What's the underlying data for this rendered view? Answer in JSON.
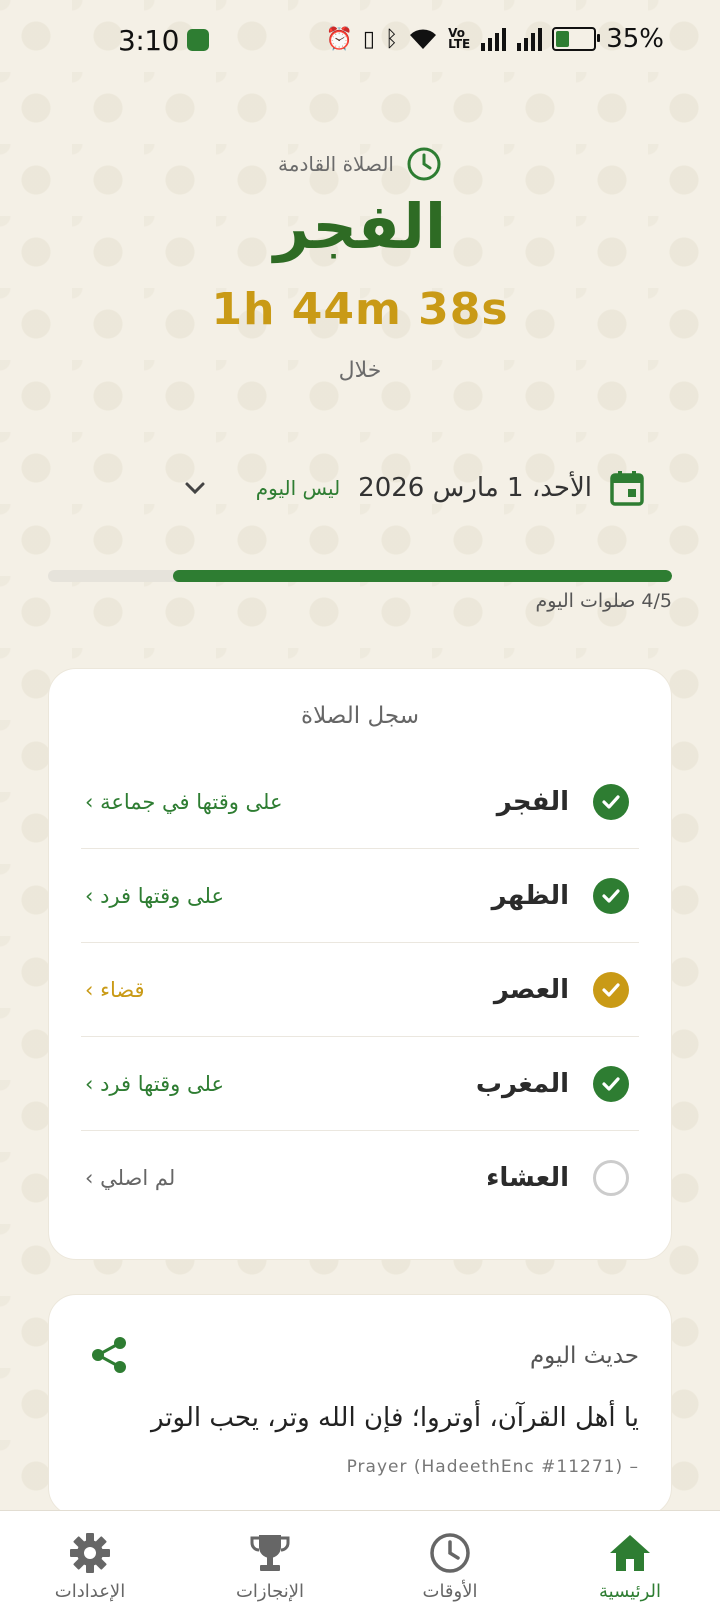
{
  "status_bar": {
    "time": "3:10",
    "battery_percent": "35%",
    "battery_level": 0.35
  },
  "header": {
    "next_prayer_label": "الصلاة القادمة",
    "prayer_name": "الفجر",
    "countdown": "1h 44m 38s",
    "within_label": "خلال"
  },
  "date": {
    "text": "الأحد، 1 مارس 2026",
    "not_today_label": "ليس اليوم"
  },
  "progress": {
    "text": "4/5 صلوات اليوم",
    "completed": 4,
    "total": 5
  },
  "log": {
    "title": "سجل الصلاة",
    "rows": [
      {
        "name": "الفجر",
        "status": "على وقتها في جماعة ›",
        "state": "done",
        "status_color": "#2e7d32",
        "icon_color": "#2e7d32"
      },
      {
        "name": "الظهر",
        "status": "على وقتها فرد ›",
        "state": "done",
        "status_color": "#2e7d32",
        "icon_color": "#2e7d32"
      },
      {
        "name": "العصر",
        "status": "قضاء ›",
        "state": "qada",
        "status_color": "#c99a16",
        "icon_color": "#c99a16"
      },
      {
        "name": "المغرب",
        "status": "على وقتها فرد ›",
        "state": "done",
        "status_color": "#2e7d32",
        "icon_color": "#2e7d32"
      },
      {
        "name": "العشاء",
        "status": "لم اصلي ›",
        "state": "none",
        "status_color": "#666666",
        "icon_color": "#cccccc"
      }
    ]
  },
  "hadith": {
    "title": "حديث اليوم",
    "text": "يا أهل القرآن، أوتروا؛ فإن الله وتر، يحب الوتر",
    "source": "Prayer (HadeethEnc #11271) –"
  },
  "bottom_nav": {
    "items": [
      {
        "label": "الرئيسية",
        "icon": "home-icon",
        "active": true
      },
      {
        "label": "الأوقات",
        "icon": "clock-icon",
        "active": false
      },
      {
        "label": "الإنجازات",
        "icon": "trophy-icon",
        "active": false
      },
      {
        "label": "الإعدادات",
        "icon": "gear-icon",
        "active": false
      }
    ]
  },
  "colors": {
    "primary_green": "#2e7d32",
    "accent_gold": "#c99a16",
    "background": "#f4f0e6"
  }
}
